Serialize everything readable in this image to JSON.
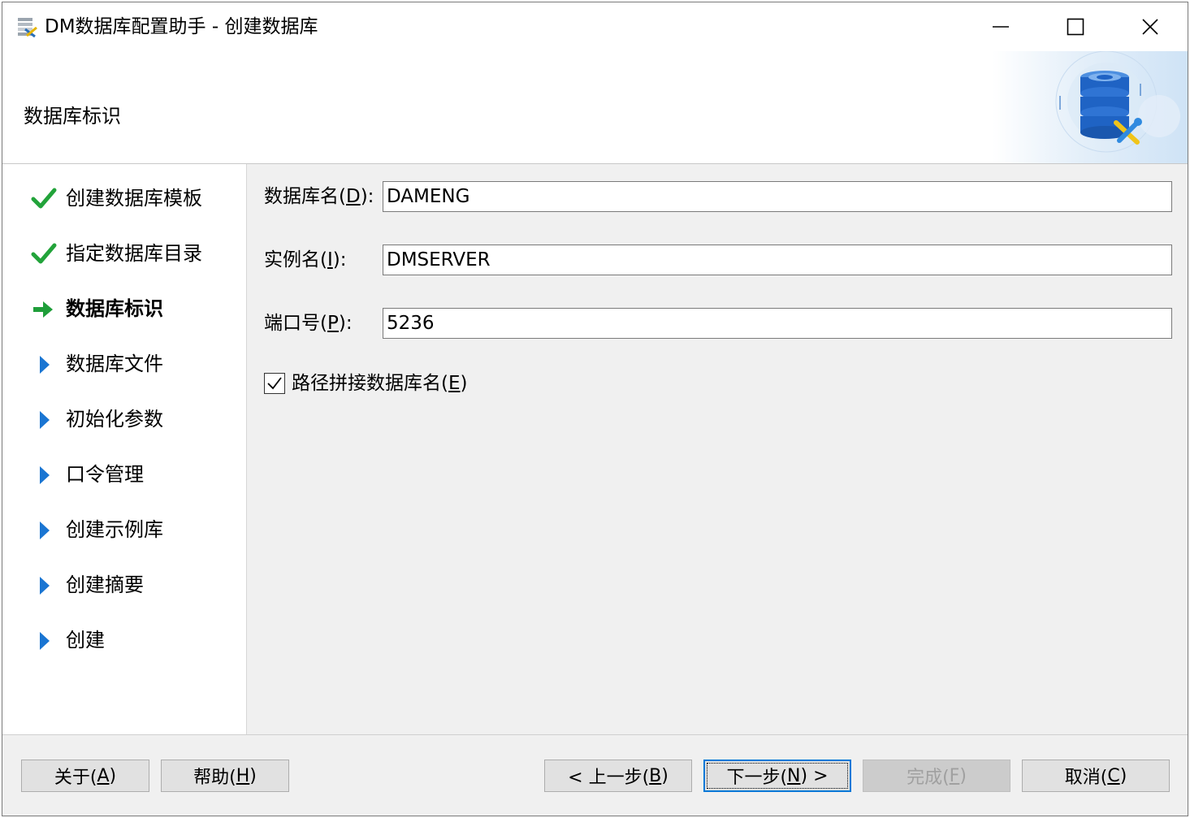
{
  "window": {
    "title": "DM数据库配置助手 - 创建数据库",
    "app_icon": "db-config-app-icon",
    "controls": [
      "minimize-icon",
      "maximize-icon",
      "close-icon"
    ]
  },
  "header": {
    "title": "数据库标识",
    "art_icon": "database-wrench-icon"
  },
  "nav": {
    "items": [
      {
        "label": "创建数据库模板",
        "state": "done",
        "icon": "checkmark-icon"
      },
      {
        "label": "指定数据库目录",
        "state": "done",
        "icon": "checkmark-icon"
      },
      {
        "label": "数据库标识",
        "state": "current",
        "icon": "arrow-right-icon"
      },
      {
        "label": "数据库文件",
        "state": "pending",
        "icon": "triangle-right-icon"
      },
      {
        "label": "初始化参数",
        "state": "pending",
        "icon": "triangle-right-icon"
      },
      {
        "label": "口令管理",
        "state": "pending",
        "icon": "triangle-right-icon"
      },
      {
        "label": "创建示例库",
        "state": "pending",
        "icon": "triangle-right-icon"
      },
      {
        "label": "创建摘要",
        "state": "pending",
        "icon": "triangle-right-icon"
      },
      {
        "label": "创建",
        "state": "pending",
        "icon": "triangle-right-icon"
      }
    ]
  },
  "form": {
    "db_name": {
      "label_pre": "数据库名(",
      "mnemonic": "D",
      "label_post": "):",
      "value": "DAMENG"
    },
    "instance_name": {
      "label_pre": "实例名(",
      "mnemonic": "I",
      "label_post": "):",
      "value": "DMSERVER"
    },
    "port": {
      "label_pre": "端口号(",
      "mnemonic": "P",
      "label_post": "):",
      "value": "5236"
    },
    "path_concat": {
      "label_pre": "路径拼接数据库名(",
      "mnemonic": "E",
      "label_post": ")",
      "checked": true
    }
  },
  "buttons": {
    "about": {
      "pre": "关于(",
      "mnemonic": "A",
      "post": ")"
    },
    "help": {
      "pre": "帮助(",
      "mnemonic": "H",
      "post": ")"
    },
    "back": {
      "pre": "< 上一步(",
      "mnemonic": "B",
      "post": ")"
    },
    "next": {
      "pre": "下一步(",
      "mnemonic": "N",
      "post": ") >"
    },
    "finish": {
      "pre": "完成(",
      "mnemonic": "F",
      "post": ")",
      "disabled": true
    },
    "cancel": {
      "pre": "取消(",
      "mnemonic": "C",
      "post": ")"
    }
  },
  "colors": {
    "check_green": "#22a33a",
    "arrow_green": "#1f9e3a",
    "triangle_blue": "#1a75d2",
    "default_button_border": "#0078d7"
  }
}
